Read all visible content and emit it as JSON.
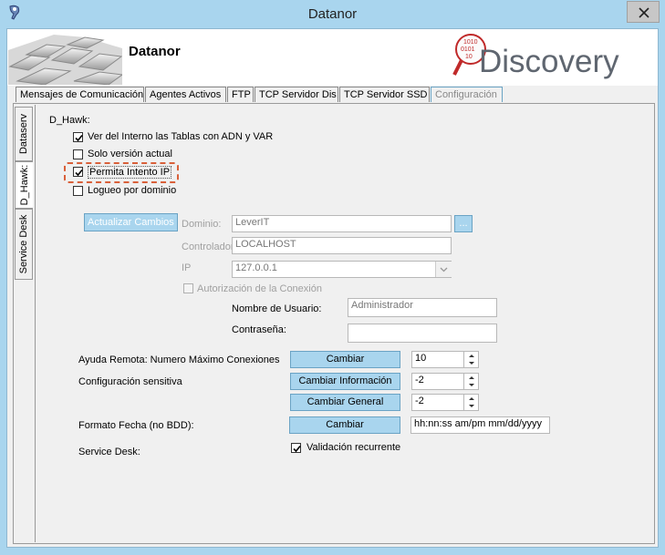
{
  "window": {
    "title": "Datanor",
    "app_name": "Datanor",
    "brand": "Discovery"
  },
  "tabs": [
    "Mensajes de Comunicación",
    "Agentes Activos",
    "FTP",
    "TCP Servidor Dis",
    "TCP Servidor SSD",
    "Configuración"
  ],
  "vertical_tabs": [
    "Dataserv",
    "D_Hawk:",
    "Service Desk"
  ],
  "dhawk": {
    "section_label": "D_Hawk:",
    "options": [
      {
        "label": "Ver del Interno las Tablas con ADN y VAR",
        "checked": true
      },
      {
        "label": "Solo versión actual",
        "checked": false
      },
      {
        "label": "Permita Intento IP",
        "checked": true
      },
      {
        "label": "Logueo por dominio",
        "checked": false
      }
    ]
  },
  "domain": {
    "apply_button": "Actualizar Cambios",
    "dominio_label": "Dominio:",
    "dominio_value": "LeverIT",
    "browse_button": "...",
    "controlador_label": "Controlador",
    "controlador_value": "LOCALHOST",
    "ip_label": "IP",
    "ip_value": "127.0.0.1",
    "auth_label": "Autorización de la Conexión",
    "user_label": "Nombre de Usuario:",
    "user_value": "Administrador",
    "password_label": "Contraseña:",
    "password_value": ""
  },
  "settings": {
    "remote_label": "Ayuda Remota: Numero Máximo Conexiones",
    "remote_button": "Cambiar",
    "remote_value": "10",
    "sensitive_label": "Configuración sensitiva",
    "sensitive_info_button": "Cambiar Información",
    "sensitive_info_value": "-2",
    "sensitive_general_button": "Cambiar General",
    "sensitive_general_value": "-2",
    "date_label": "Formato Fecha (no BDD):",
    "date_button": "Cambiar",
    "date_value": "hh:nn:ss am/pm mm/dd/yyyy",
    "service_desk_label": "Service Desk:",
    "recurrent_label": "Validación recurrente",
    "recurrent_checked": true
  }
}
